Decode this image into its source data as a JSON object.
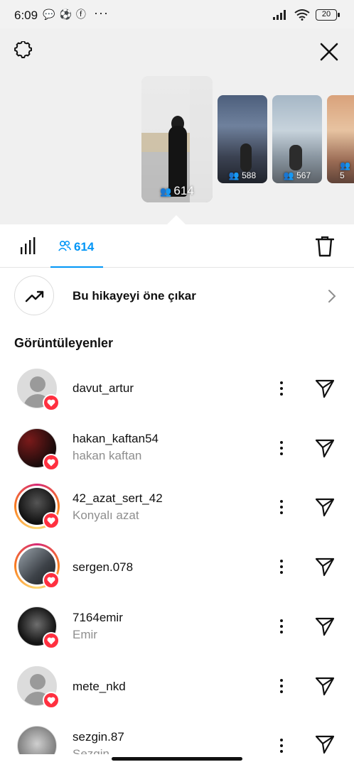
{
  "status_bar": {
    "time": "6:09",
    "dots": "···",
    "battery": "20"
  },
  "thumbnails": [
    {
      "count": "614"
    },
    {
      "count": "588"
    },
    {
      "count": "567"
    },
    {
      "count": "5"
    }
  ],
  "tabs": {
    "viewers_count": "614"
  },
  "promote": {
    "label": "Bu hikayeyi öne çıkar"
  },
  "section_title": "Görüntüleyenler",
  "viewers": [
    {
      "username": "davut_artur",
      "fullname": ""
    },
    {
      "username": "hakan_kaftan54",
      "fullname": "hakan kaftan"
    },
    {
      "username": "42_azat_sert_42",
      "fullname": "Konyalı azat"
    },
    {
      "username": "sergen.078",
      "fullname": ""
    },
    {
      "username": "7164emir",
      "fullname": "Emir"
    },
    {
      "username": "mete_nkd",
      "fullname": ""
    },
    {
      "username": "sezgin.87",
      "fullname": "Sezgin"
    }
  ],
  "colors": {
    "accent": "#0095f6",
    "like": "#ff3040",
    "secondary_text": "#8e8e8e"
  }
}
